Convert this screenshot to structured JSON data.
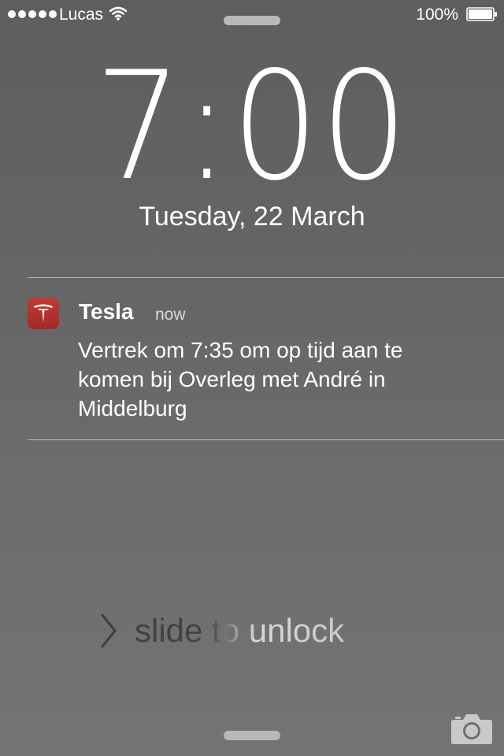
{
  "status_bar": {
    "signal_dots": 5,
    "carrier": "Lucas",
    "wifi_icon": "wifi-icon",
    "battery_percent": "100%",
    "battery_icon": "battery-full-icon"
  },
  "lock_screen": {
    "time": "7:00",
    "date": "Tuesday, 22 March"
  },
  "notification": {
    "app_icon": "tesla-logo-icon",
    "app_name": "Tesla",
    "time": "now",
    "message": "Vertrek om 7:35 om op tijd aan te komen bij Overleg met André in Middelburg"
  },
  "unlock": {
    "chevron_icon": "chevron-right-icon",
    "label": "slide to unlock"
  },
  "camera": {
    "icon": "camera-icon"
  },
  "colors": {
    "background": "#666666",
    "tesla_red": "#b3302c",
    "text": "#ffffff"
  }
}
